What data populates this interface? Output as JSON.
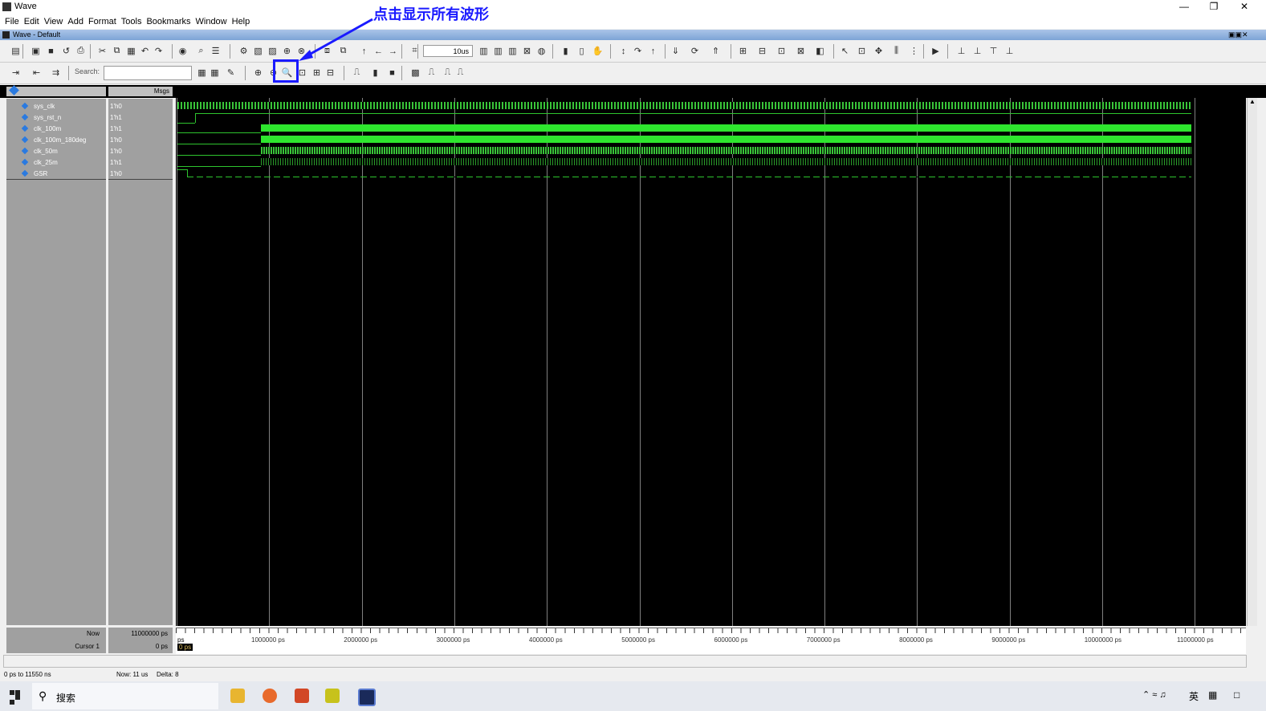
{
  "window": {
    "title": "Wave",
    "inner_title": "Wave - Default"
  },
  "menu": [
    "File",
    "Edit",
    "View",
    "Add",
    "Format",
    "Tools",
    "Bookmarks",
    "Window",
    "Help"
  ],
  "toolbar": {
    "run_length": "10us",
    "search_label": "Search:"
  },
  "annotation": {
    "text": "点击显示所有波形"
  },
  "panes": {
    "msgs_header": "Msgs"
  },
  "signals": [
    {
      "name": "sys_clk",
      "value": "1'h0"
    },
    {
      "name": "sys_rst_n",
      "value": "1'h1"
    },
    {
      "name": "clk_100m",
      "value": "1'h1"
    },
    {
      "name": "clk_100m_180deg",
      "value": "1'h0"
    },
    {
      "name": "clk_50m",
      "value": "1'h0"
    },
    {
      "name": "clk_25m",
      "value": "1'h1"
    },
    {
      "name": "GSR",
      "value": "1'h0"
    }
  ],
  "bottom": {
    "now_label": "Now",
    "now_value": "11000000 ps",
    "cursor_label": "Cursor 1",
    "cursor_value": "0 ps",
    "cursor_tag": "0 ps",
    "scale_start": "ps",
    "ticks": [
      "1000000 ps",
      "2000000 ps",
      "3000000 ps",
      "4000000 ps",
      "5000000 ps",
      "6000000 ps",
      "7000000 ps",
      "8000000 ps",
      "9000000 ps",
      "10000000 ps",
      "11000000 ps"
    ]
  },
  "status": {
    "range": "0 ps to 11550 ns",
    "now": "Now: 11 us",
    "delta": "Delta: 8"
  },
  "taskbar": {
    "search_placeholder": "搜索",
    "ime": "英"
  },
  "colors": {
    "wave": "#2ee62e",
    "annotation": "#1a1aff",
    "background": "#000000"
  }
}
